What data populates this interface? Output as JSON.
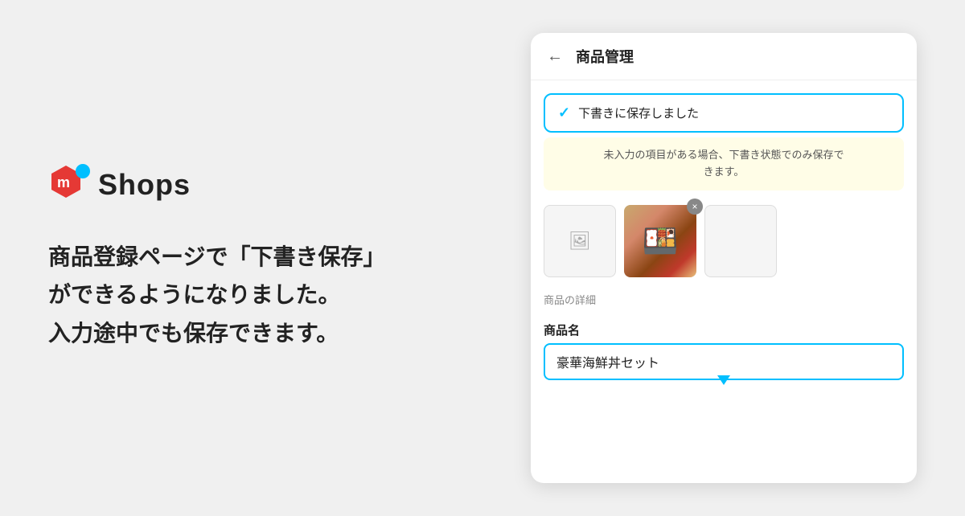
{
  "logo": {
    "text": "Shops"
  },
  "left": {
    "line1": "商品登録ページで「下書き保存」",
    "line2": "ができるようになりました。",
    "line3": "入力途中でも保存できます。"
  },
  "phone": {
    "back_label": "←",
    "title": "商品管理",
    "notification": "下書きに保存しました",
    "warning": "未入力の項目がある場合、下書き状態でのみ保存で\nきます。",
    "section_label": "商品の詳細",
    "field_label": "商品名",
    "field_value": "豪華海鮮丼セット",
    "close_icon": "×"
  },
  "colors": {
    "accent": "#00BFFF",
    "warning_bg": "#fffde7",
    "logo_red": "#e53935",
    "logo_dot": "#29b6f6"
  }
}
